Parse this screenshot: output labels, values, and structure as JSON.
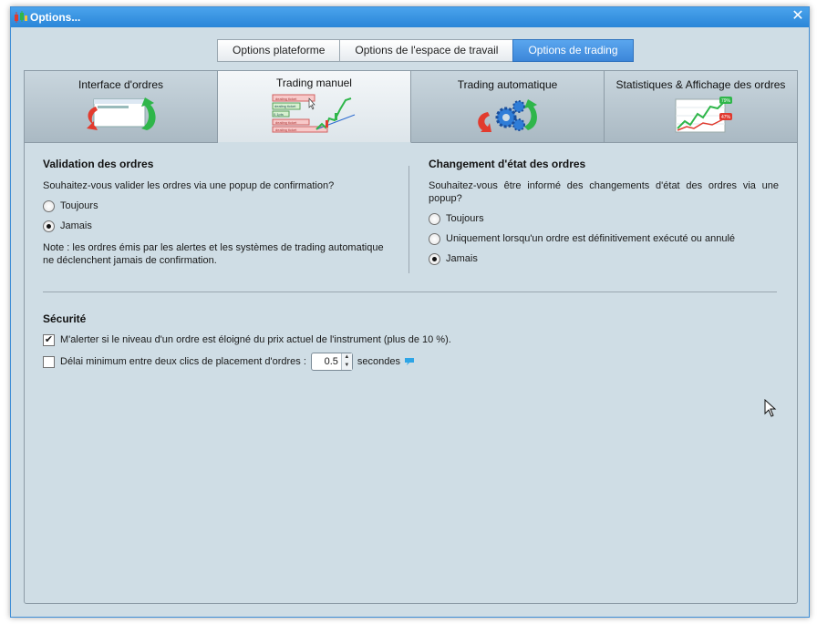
{
  "window": {
    "title": "Options..."
  },
  "top_tabs": [
    {
      "label": "Options plateforme"
    },
    {
      "label": "Options de l'espace de travail"
    },
    {
      "label": "Options de trading"
    }
  ],
  "sub_tabs": [
    {
      "label": "Interface d'ordres",
      "icon": "order-interface-icon"
    },
    {
      "label": "Trading manuel",
      "icon": "manual-trading-icon",
      "ticket_texts": [
        "dealing ticket",
        "dealing ticket",
        "0.1pts",
        "dealing ticket",
        "dealing ticket"
      ]
    },
    {
      "label": "Trading automatique",
      "icon": "gears-icon"
    },
    {
      "label": "Statistiques & Affichage des ordres",
      "icon": "statistics-icon",
      "badges": [
        "79%",
        "47%"
      ]
    }
  ],
  "validation": {
    "heading": "Validation des ordres",
    "question": "Souhaitez-vous valider les ordres via une popup de confirmation?",
    "options": [
      "Toujours",
      "Jamais"
    ],
    "selected": "Jamais",
    "note": "Note : les ordres émis par les alertes et les systèmes de trading automatique ne déclenchent jamais de confirmation."
  },
  "state_change": {
    "heading": "Changement d'état des ordres",
    "question": "Souhaitez-vous être informé des changements d'état des ordres via une popup?",
    "options": [
      "Toujours",
      "Uniquement lorsqu'un ordre est définitivement exécuté ou annulé",
      "Jamais"
    ],
    "selected": "Jamais"
  },
  "security": {
    "heading": "Sécurité",
    "alert_label": "M'alerter si le niveau d'un ordre est éloigné du prix actuel de l'instrument (plus de 10 %).",
    "alert_checked": true,
    "delay_label": "Délai minimum entre deux clics de placement d'ordres :",
    "delay_checked": false,
    "delay_value": "0.5",
    "delay_unit": "secondes"
  },
  "colors": {
    "accent": "#3c86d9",
    "background": "#cfdde5"
  }
}
